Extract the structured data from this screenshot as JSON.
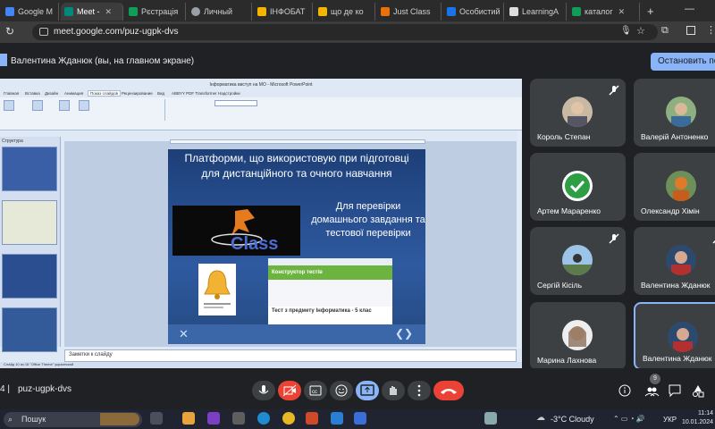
{
  "browser": {
    "tabs": [
      {
        "label": "Google М",
        "color": "#4285f4"
      },
      {
        "label": "Meet -",
        "color": "#00897b"
      },
      {
        "label": "Рєстрація",
        "color": "#0f9d58"
      },
      {
        "label": "Личный",
        "color": "#9aa0a6"
      },
      {
        "label": "ІНФОБАТ",
        "color": "#f4b400"
      },
      {
        "label": "що де ко",
        "color": "#f4b400"
      },
      {
        "label": "Just Class",
        "color": "#e8710a"
      },
      {
        "label": "Особистий",
        "color": "#1a73e8"
      },
      {
        "label": "LearningA",
        "color": "#dddddd"
      },
      {
        "label": "каталог",
        "color": "#0f9d58"
      }
    ],
    "url": "meet.google.com/puz-ugpk-dvs"
  },
  "meet": {
    "presenter_label": "Валентина Жданюк (вы, на главном экране)",
    "stop_button": "Остановить показ",
    "meeting_code": "puz-ugpk-dvs",
    "participant_count": "9",
    "participants": [
      {
        "name": "Король Степан",
        "muted": true
      },
      {
        "name": "Валерій Антоненко",
        "muted": false
      },
      {
        "name": "Артем Мараренко",
        "muted": false
      },
      {
        "name": "Олександр Хімін",
        "muted": false
      },
      {
        "name": "Сергій Кісіль",
        "muted": true
      },
      {
        "name": "Валентина Жданюк",
        "muted": true
      },
      {
        "name": "Марина Лахнова",
        "muted": false
      },
      {
        "name": "Валентина Жданюк",
        "muted": false
      }
    ],
    "notes_label": "Заметки к слайду"
  },
  "ppt": {
    "window_title": "Інформатика виступ на МО - Microsoft PowerPoint",
    "ribbon_tabs": [
      "Главная",
      "Вставка",
      "Дизайн",
      "Анимация",
      "Показ слайдов",
      "Рецензирование",
      "Вид",
      "ABBYY PDF Transformer",
      "Надстройки"
    ],
    "thumbs_tab": "Структура",
    "status": "Слайд 10 из 16   \"Office Theme\"   украинский"
  },
  "slide": {
    "title": "Платформи, що використовую при підготовці для дистанційного та очного навчання",
    "right_text": "Для перевірки домашнього завдання та тестової перевірки",
    "class_word": "Class",
    "test_header": "Конструктор тестів",
    "test_title": "Тест з предмету Інформатика - 5 клас"
  },
  "taskbar": {
    "search": "Пошук",
    "weather": "-3°C  Cloudy",
    "lang": "УКР",
    "time": "11:14",
    "date": "10.01.2024"
  }
}
